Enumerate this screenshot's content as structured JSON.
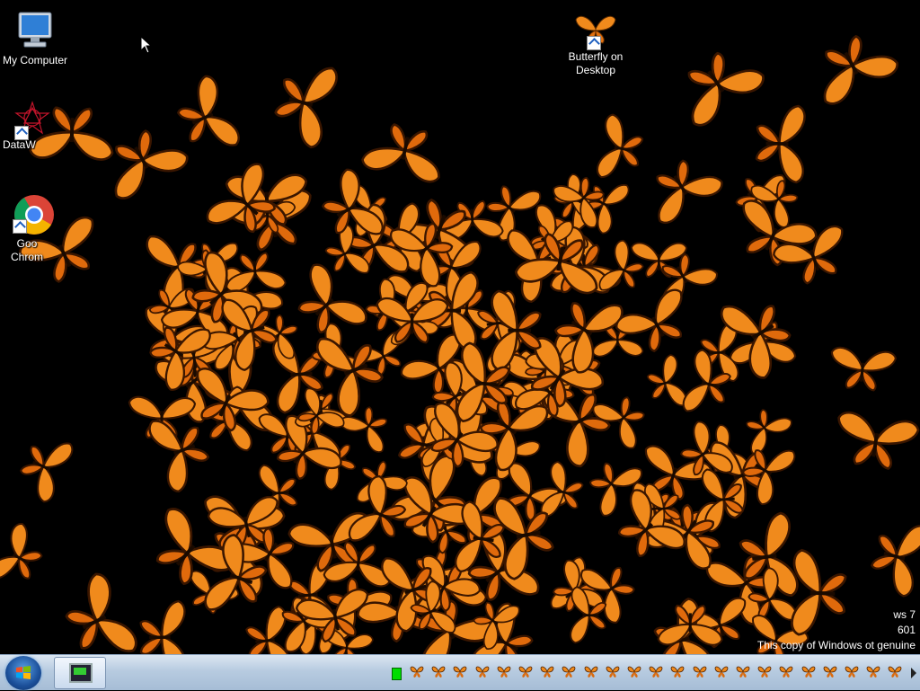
{
  "desktop": {
    "icons": [
      {
        "label": "My Computer",
        "icon": "computer-icon"
      },
      {
        "label": "DataW",
        "icon": "datawave-icon"
      },
      {
        "label": "Goo Chrom",
        "label_line1": "Goo",
        "label_line2": "Chrom",
        "icon": "chrome-icon"
      },
      {
        "label": "Butterfly on Desktop",
        "label_line1": "Butterfly on",
        "label_line2": "Desktop",
        "icon": "butterfly-icon"
      }
    ],
    "watermark": {
      "line1": "ws 7",
      "line2": "601",
      "line3": "This copy of Windows    ot genuine"
    },
    "wallpaper_color": "#000000",
    "butterfly_color": "#f08a1c"
  },
  "taskbar": {
    "start_label": "Start",
    "task_item": "running-program",
    "tray_icons_count_label": "",
    "colors": {
      "bar": "#b7cbe0",
      "start": "#1b4f99"
    }
  }
}
